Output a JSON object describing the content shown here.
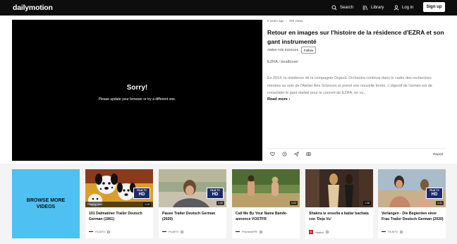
{
  "header": {
    "logo": "dailymotion",
    "search_label": "Search",
    "library_label": "Library",
    "login_label": "Log in",
    "signup_label": "Sign up"
  },
  "player": {
    "error_title": "Sorry!",
    "error_message": "Please update your browser or try a different one."
  },
  "video": {
    "age": "6 years ago",
    "views": "183 views",
    "title": "Retour en images sur l'histoire de la résidence d'EZRA et son gant instrumenté",
    "channel": "Atelier Arts Sciences",
    "follow_label": "Follow",
    "tags": "EZRA / beatboxer",
    "description": "En 2014, la résidence de la compagnie Organic Orchestra continue dans le cadre des recherches menées au sein de l'Atelier Arts Sciences et prend une nouvelle forme. L'objectif de l'année est de consolider le gant réalisé pour le concert de EZRA, en vu...",
    "read_more": "Read more",
    "report_label": "Report"
  },
  "browse_label": "BROWSE MORE VIDEOS",
  "cards": [
    {
      "title": "101 Dalmatiner Trailer Deutsch German (1961)",
      "channel": "FILMTV",
      "duration": "1:18",
      "badge": "FILM TV",
      "badge_hd": "HD",
      "playing_label": "Playing next"
    },
    {
      "title": "Pause Trailer Deutsch German (2020)",
      "channel": "FILMTV",
      "duration": "1:42",
      "badge": "FILM TV",
      "badge_hd": "HD"
    },
    {
      "title": "Call Me By Your Name Bande-annonce VOSTFR",
      "channel": "PremiereFR",
      "duration": "2:22"
    },
    {
      "title": "Shakira te enseña a bailar bachata con 'Deja Vu'",
      "channel": "clasico",
      "duration": "1:06",
      "channel_badge": "C"
    },
    {
      "title": "Verlangen - Die Begierden einer Frau Trailer Deutsch German (2020)",
      "channel": "FILMTV",
      "duration": "1:41",
      "badge": "FILM TV",
      "badge_hd": "HD"
    }
  ]
}
